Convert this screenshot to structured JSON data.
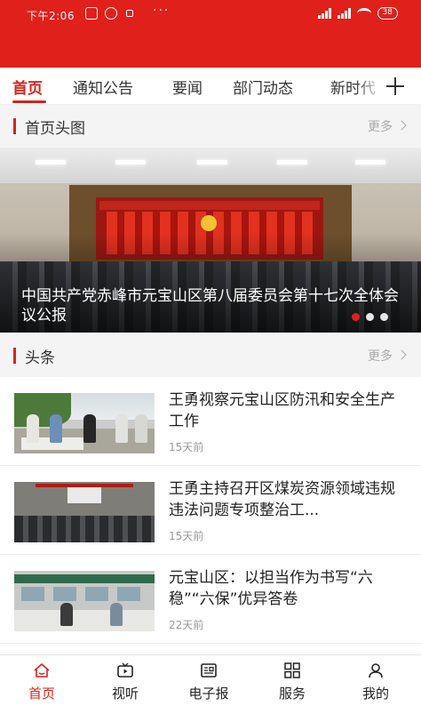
{
  "status_bar": {
    "time": "下午2:06",
    "battery": "38"
  },
  "tabs": [
    {
      "label": "首页",
      "active": true
    },
    {
      "label": "通知公告"
    },
    {
      "label": "要闻"
    },
    {
      "label": "部门动态"
    },
    {
      "label": "新时代"
    }
  ],
  "headline_section": {
    "title": "首页头图",
    "more": "更多"
  },
  "banner": {
    "caption": "中国共产党赤峰市元宝山区第八届委员会第十七次全体会议公报",
    "slide_count": 3,
    "active_slide": 1
  },
  "news_section": {
    "title": "头条",
    "more": "更多"
  },
  "news": [
    {
      "title": "王勇视察元宝山区防汛和安全生产工作",
      "time": "15天前"
    },
    {
      "title": "王勇主持召开区煤炭资源领域违规违法问题专项整治工...",
      "time": "15天前"
    },
    {
      "title": "元宝山区：以担当作为书写“六稳”“六保”优异答卷",
      "time": "22天前"
    }
  ],
  "bottom_nav": [
    {
      "label": "首页",
      "icon": "home-icon",
      "active": true
    },
    {
      "label": "视听",
      "icon": "tv-icon"
    },
    {
      "label": "电子报",
      "icon": "newspaper-icon"
    },
    {
      "label": "服务",
      "icon": "grid-icon"
    },
    {
      "label": "我的",
      "icon": "user-icon"
    }
  ],
  "colors": {
    "brand_red": "#e0201b",
    "active_text": "#d6231d",
    "muted": "#999999"
  }
}
